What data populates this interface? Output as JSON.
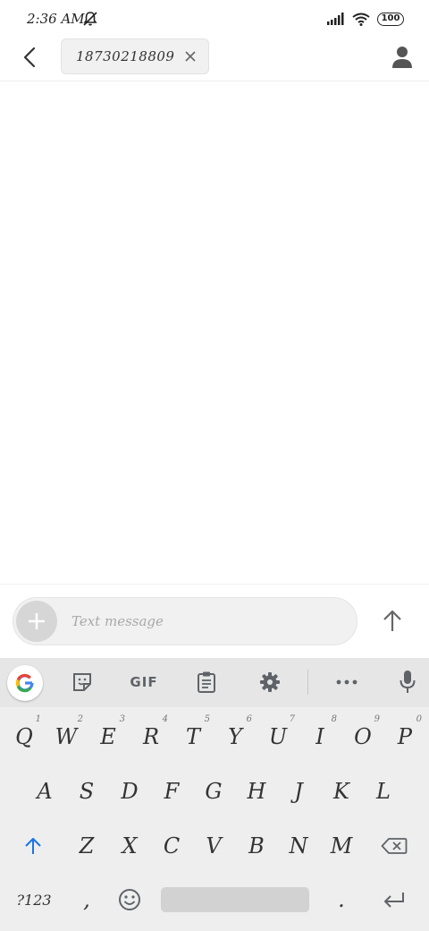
{
  "status_bar": {
    "time": "2:36 AM",
    "battery": "100",
    "icons": [
      "mute-icon",
      "signal-icon",
      "wifi-icon",
      "battery-icon"
    ]
  },
  "app_bar": {
    "recipient": "18730218809",
    "icons": [
      "back-arrow-icon",
      "close-icon",
      "person-icon"
    ]
  },
  "compose": {
    "placeholder": "Text message",
    "icons": [
      "plus-icon",
      "send-arrow-icon"
    ]
  },
  "keyboard": {
    "toolbar": {
      "gif_label": "GIF",
      "icons": [
        "google-icon",
        "sticker-icon",
        "clipboard-icon",
        "gear-icon",
        "more-icon",
        "mic-icon"
      ]
    },
    "row1": [
      {
        "label": "Q",
        "hint": "1"
      },
      {
        "label": "W",
        "hint": "2"
      },
      {
        "label": "E",
        "hint": "3"
      },
      {
        "label": "R",
        "hint": "4"
      },
      {
        "label": "T",
        "hint": "5"
      },
      {
        "label": "Y",
        "hint": "6"
      },
      {
        "label": "U",
        "hint": "7"
      },
      {
        "label": "I",
        "hint": "8"
      },
      {
        "label": "O",
        "hint": "9"
      },
      {
        "label": "P",
        "hint": "0"
      }
    ],
    "row2": [
      "A",
      "S",
      "D",
      "F",
      "G",
      "H",
      "J",
      "K",
      "L"
    ],
    "row3": [
      "Z",
      "X",
      "C",
      "V",
      "B",
      "N",
      "M"
    ],
    "symbols_label": "?123",
    "comma": ",",
    "period": ".",
    "accent_color": "#1a73e8"
  }
}
